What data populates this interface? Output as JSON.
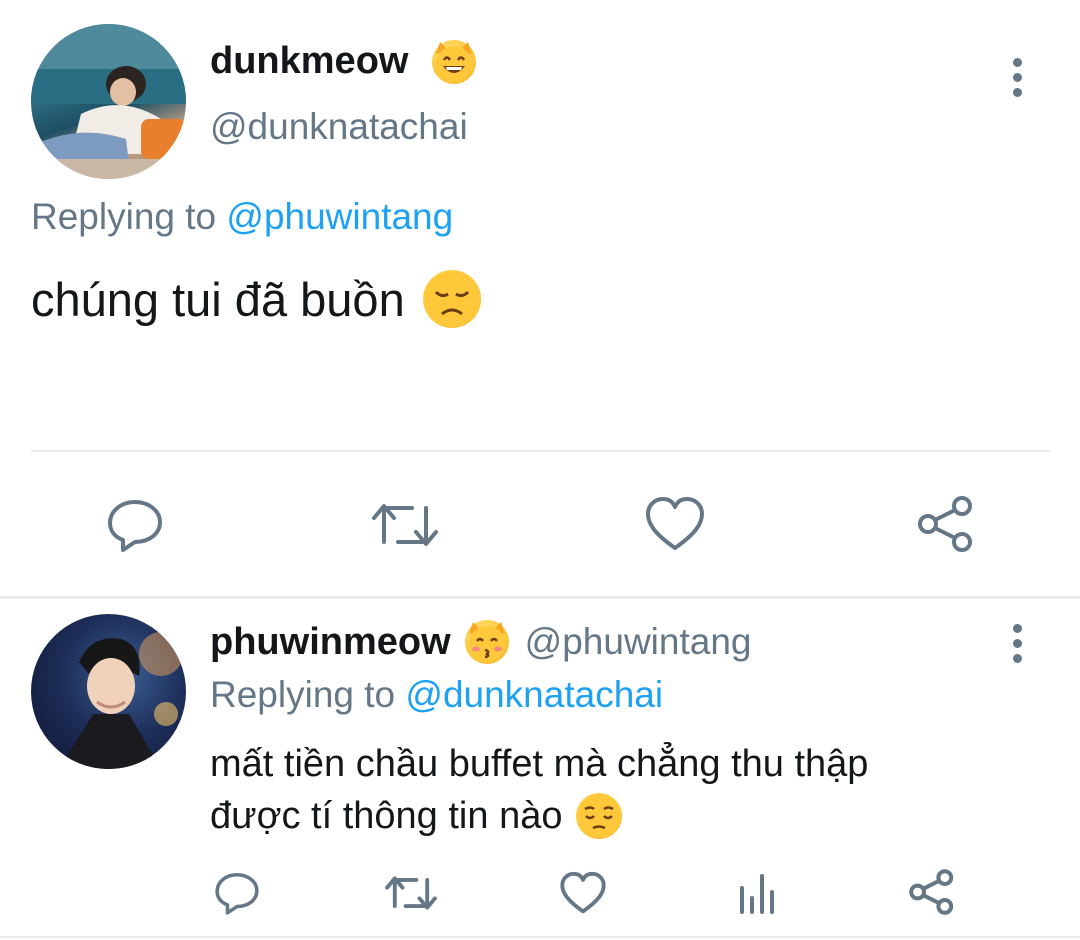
{
  "tweet1": {
    "display_name": "dunkmeow",
    "name_emoji": "smiling-cat-emoji",
    "handle": "@dunknatachai",
    "replying_prefix": "Replying to",
    "replying_to": "@phuwintang",
    "text": "chúng tui đã buồn",
    "text_emoji": "disappointed-face-emoji",
    "actions": [
      "reply-icon",
      "retweet-icon",
      "like-icon",
      "share-icon"
    ]
  },
  "tweet2": {
    "display_name": "phuwinmeow",
    "name_emoji": "kissing-cat-emoji",
    "handle": "@phuwintang",
    "replying_prefix": "Replying to",
    "replying_to": "@dunknatachai",
    "text_line1": "mất tiền chầu buffet mà chẳng thu thập",
    "text_line2": "được tí thông tin nào",
    "text_emoji": "pensive-face-emoji",
    "actions": [
      "reply-icon",
      "retweet-icon",
      "like-icon",
      "analytics-icon",
      "share-icon"
    ]
  },
  "colors": {
    "text": "#14171a",
    "secondary": "#657786",
    "accent": "#1da1f2",
    "divider": "#e6ecf0"
  }
}
